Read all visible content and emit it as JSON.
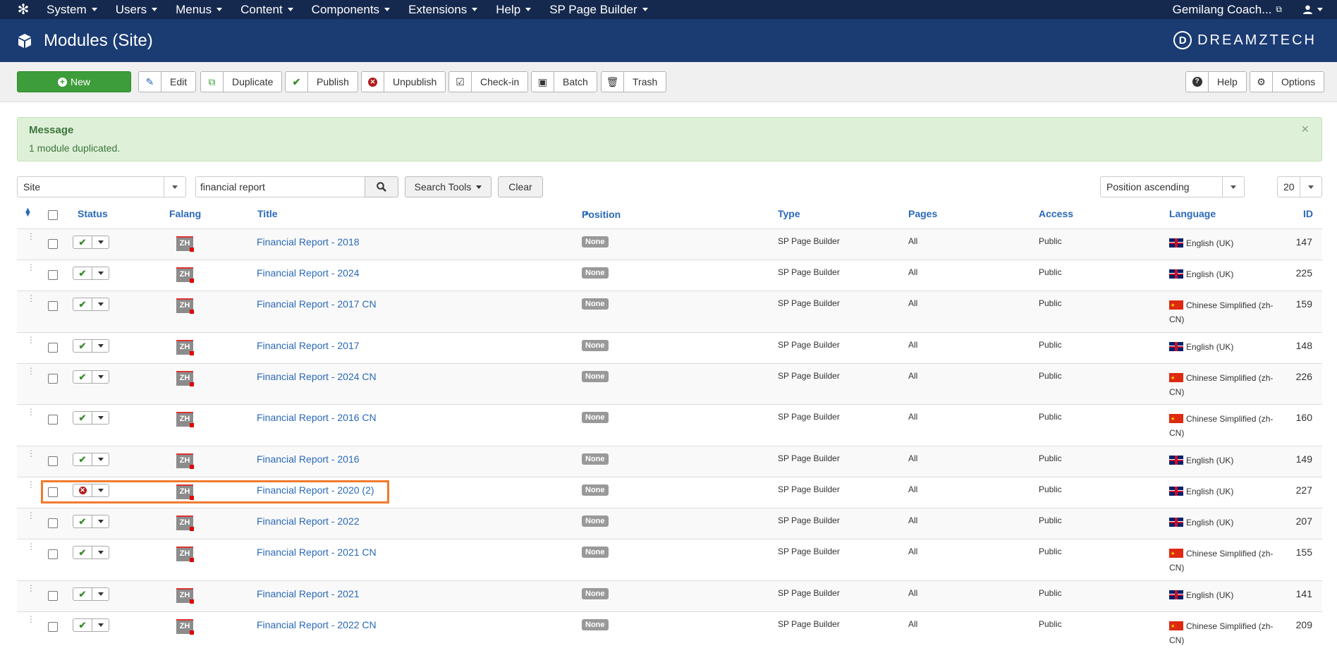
{
  "nav": {
    "menus": [
      "System",
      "Users",
      "Menus",
      "Content",
      "Components",
      "Extensions",
      "Help",
      "SP Page Builder"
    ],
    "site_name": "Gemilang Coach..."
  },
  "header": {
    "title": "Modules (Site)",
    "brand": "DREAMZTECH"
  },
  "toolbar": {
    "new": "New",
    "edit": "Edit",
    "duplicate": "Duplicate",
    "publish": "Publish",
    "unpublish": "Unpublish",
    "checkin": "Check-in",
    "batch": "Batch",
    "trash": "Trash",
    "help": "Help",
    "options": "Options"
  },
  "message": {
    "title": "Message",
    "body": "1 module duplicated."
  },
  "filters": {
    "client": "Site",
    "search": "financial report",
    "search_tools": "Search Tools",
    "clear": "Clear",
    "ordering": "Position ascending",
    "limit": "20"
  },
  "columns": {
    "status": "Status",
    "falang": "Falang",
    "title": "Title",
    "position": "Position",
    "type": "Type",
    "pages": "Pages",
    "access": "Access",
    "language": "Language",
    "id": "ID"
  },
  "rows": [
    {
      "title": "Financial Report - 2018",
      "published": true,
      "position": "None",
      "type": "SP Page Builder",
      "pages": "All",
      "access": "Public",
      "language": "English (UK)",
      "lang_flag": "uk",
      "id": "147"
    },
    {
      "title": "Financial Report - 2024",
      "published": true,
      "position": "None",
      "type": "SP Page Builder",
      "pages": "All",
      "access": "Public",
      "language": "English (UK)",
      "lang_flag": "uk",
      "id": "225"
    },
    {
      "title": "Financial Report - 2017 CN",
      "published": true,
      "position": "None",
      "type": "SP Page Builder",
      "pages": "All",
      "access": "Public",
      "language": "Chinese Simplified (zh-CN)",
      "lang_flag": "cn",
      "id": "159"
    },
    {
      "title": "Financial Report - 2017",
      "published": true,
      "position": "None",
      "type": "SP Page Builder",
      "pages": "All",
      "access": "Public",
      "language": "English (UK)",
      "lang_flag": "uk",
      "id": "148"
    },
    {
      "title": "Financial Report - 2024 CN",
      "published": true,
      "position": "None",
      "type": "SP Page Builder",
      "pages": "All",
      "access": "Public",
      "language": "Chinese Simplified (zh-CN)",
      "lang_flag": "cn",
      "id": "226"
    },
    {
      "title": "Financial Report - 2016 CN",
      "published": true,
      "position": "None",
      "type": "SP Page Builder",
      "pages": "All",
      "access": "Public",
      "language": "Chinese Simplified (zh-CN)",
      "lang_flag": "cn",
      "id": "160"
    },
    {
      "title": "Financial Report - 2016",
      "published": true,
      "position": "None",
      "type": "SP Page Builder",
      "pages": "All",
      "access": "Public",
      "language": "English (UK)",
      "lang_flag": "uk",
      "id": "149"
    },
    {
      "title": "Financial Report - 2020 (2)",
      "published": false,
      "position": "None",
      "type": "SP Page Builder",
      "pages": "All",
      "access": "Public",
      "language": "English (UK)",
      "lang_flag": "uk",
      "id": "227"
    },
    {
      "title": "Financial Report - 2022",
      "published": true,
      "position": "None",
      "type": "SP Page Builder",
      "pages": "All",
      "access": "Public",
      "language": "English (UK)",
      "lang_flag": "uk",
      "id": "207"
    },
    {
      "title": "Financial Report - 2021 CN",
      "published": true,
      "position": "None",
      "type": "SP Page Builder",
      "pages": "All",
      "access": "Public",
      "language": "Chinese Simplified (zh-CN)",
      "lang_flag": "cn",
      "id": "155"
    },
    {
      "title": "Financial Report - 2021",
      "published": true,
      "position": "None",
      "type": "SP Page Builder",
      "pages": "All",
      "access": "Public",
      "language": "English (UK)",
      "lang_flag": "uk",
      "id": "141"
    },
    {
      "title": "Financial Report - 2022 CN",
      "published": true,
      "position": "None",
      "type": "SP Page Builder",
      "pages": "All",
      "access": "Public",
      "language": "Chinese Simplified (zh-CN)",
      "lang_flag": "cn",
      "id": "209"
    }
  ],
  "falang_badge": "ZH",
  "colors": {
    "nav": "#15294e",
    "header": "#1b3b73",
    "new_button": "#3d9d3a",
    "link": "#2a69b8",
    "highlight": "#f07b2e"
  }
}
